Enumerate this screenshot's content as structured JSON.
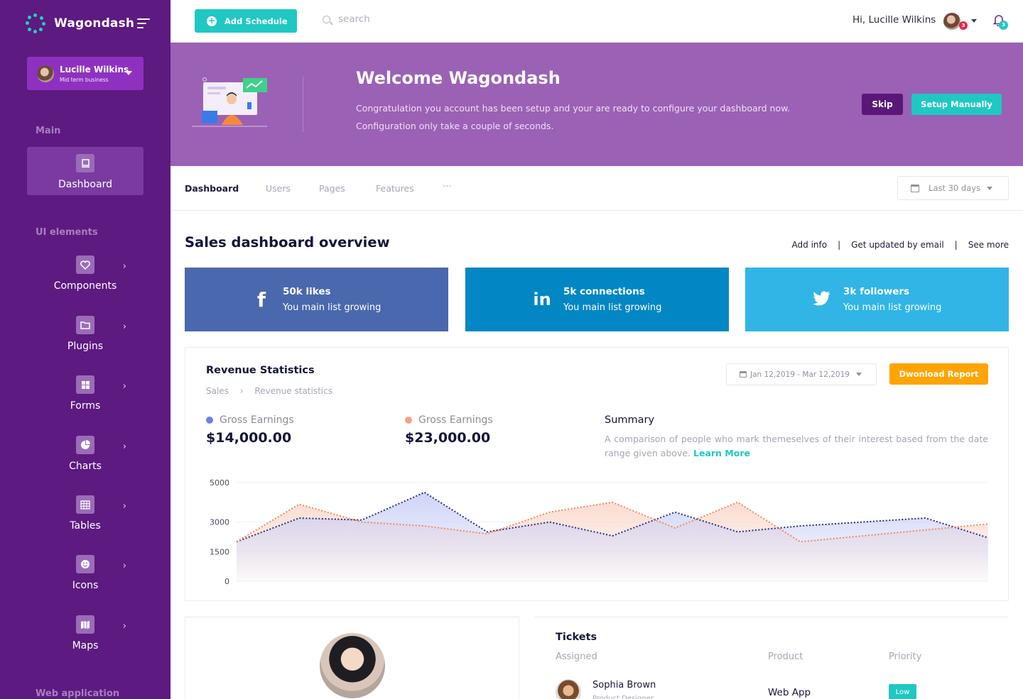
{
  "brand": {
    "name": "Wagondash"
  },
  "user": {
    "name": "Lucille Wilkins",
    "subtitle": "Mid term business"
  },
  "sidebar": {
    "sections": [
      "Main",
      "UI elements",
      "Web application"
    ],
    "items": [
      {
        "label": "Dashboard",
        "icon": "monitor-icon",
        "active": true
      },
      {
        "label": "Components",
        "icon": "heart-icon"
      },
      {
        "label": "Plugins",
        "icon": "folder-icon"
      },
      {
        "label": "Forms",
        "icon": "grid-icon"
      },
      {
        "label": "Charts",
        "icon": "pie-chart-icon"
      },
      {
        "label": "Tables",
        "icon": "table-icon"
      },
      {
        "label": "Icons",
        "icon": "smiley-icon"
      },
      {
        "label": "Maps",
        "icon": "map-icon"
      }
    ]
  },
  "topbar": {
    "add_label": "Add Schedule",
    "search_placeholder": "search",
    "greeting": "Hi, Lucille Wilkins",
    "avatar_badge": "3",
    "bell_badge": "3"
  },
  "banner": {
    "title": "Welcome Wagondash",
    "description": "Congratulation you account has been setup and your are ready to configure your dashboard now. Configuration only take a couple of seconds.",
    "skip_label": "Skip",
    "manual_label": "Setup Manually"
  },
  "tabs": {
    "items": [
      "Dashboard",
      "Users",
      "Pages",
      "Features",
      "⋯"
    ],
    "range_label": "Last 30 days"
  },
  "overview": {
    "title": "Sales dashboard overview",
    "links": [
      "Add info",
      "Get updated by email",
      "See more"
    ]
  },
  "social": [
    {
      "icon": "facebook-icon",
      "glyph": "f",
      "title": "50k likes",
      "subtitle": "You main list growing",
      "color": "#4a68ad"
    },
    {
      "icon": "linkedin-icon",
      "glyph": "in",
      "title": "5k connections",
      "subtitle": "You main list growing",
      "color": "#0287c4"
    },
    {
      "icon": "twitter-icon",
      "glyph": "🐦",
      "title": "3k followers",
      "subtitle": "You main list growing",
      "color": "#30b5e6"
    }
  ],
  "revenue": {
    "title": "Revenue Statistics",
    "crumb_parent": "Sales",
    "crumb_current": "Revenue statistics",
    "range_label": "Jan 12,2019 - Mar 12,2019",
    "download_label": "Dwonload Report",
    "earnings": [
      {
        "label": "Gross Earnings",
        "value": "$14,000.00",
        "color": "#6c7ff2"
      },
      {
        "label": "Gross Earnings",
        "value": "$23,000.00",
        "color": "#f7a084"
      }
    ],
    "summary_title": "Summary",
    "summary_text": "A comparison of people who mark themeselves of their interest based from the date range given above.",
    "learn_more": "Learn More"
  },
  "chart_data": {
    "type": "area",
    "y_ticks": [
      "5000",
      "3000",
      "1500",
      "0"
    ],
    "ylim": [
      0,
      5000
    ],
    "x": [
      0,
      1,
      2,
      3,
      4,
      5,
      6,
      7,
      8,
      9,
      10,
      11,
      12
    ],
    "series": [
      {
        "values": [
          2000,
          3200,
          3100,
          4500,
          2500,
          3000,
          2300,
          3500,
          2500,
          2800,
          3000,
          3200,
          2200
        ],
        "color": "#2b2f77",
        "fill": "#c9cff6"
      },
      {
        "values": [
          2000,
          3900,
          3000,
          2800,
          2400,
          3500,
          4000,
          2700,
          4000,
          2000,
          2300,
          2600,
          2900
        ],
        "color": "#f2875f",
        "fill": "#fbd9cc"
      }
    ],
    "grid": true,
    "legend": "none"
  },
  "tickets": {
    "title": "Tickets",
    "headers": [
      "Assigned",
      "Product",
      "Priority"
    ],
    "rows": [
      {
        "name": "Sophia Brown",
        "role": "Product Designer",
        "product": "Web App",
        "priority": "Low"
      }
    ]
  }
}
